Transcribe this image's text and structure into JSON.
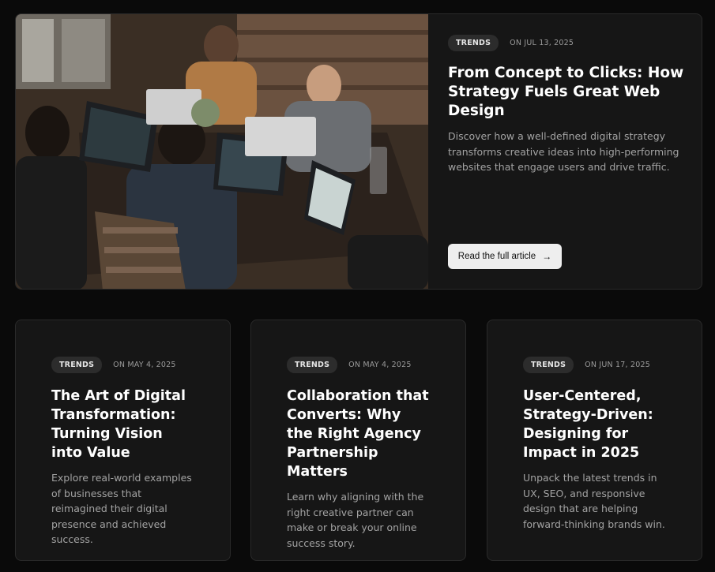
{
  "featured": {
    "tag": "TRENDS",
    "date": "ON JUL 13, 2025",
    "title": "From Concept to Clicks: How Strategy Fuels Great Web Design",
    "description": "Discover how a well-defined digital strategy transforms creative ideas into high-performing websites that engage users and drive traffic.",
    "button_label": "Read the full article",
    "button_icon": "arrow-right-icon",
    "image_subject": "team-working-on-laptops"
  },
  "cards": [
    {
      "tag": "TRENDS",
      "date": "ON MAY 4, 2025",
      "title": "The Art of Digital Transformation: Turning Vision into Value",
      "description": "Explore real-world examples of businesses that reimagined their digital presence and achieved success."
    },
    {
      "tag": "TRENDS",
      "date": "ON MAY 4, 2025",
      "title": "Collaboration that Converts: Why the Right Agency Partnership Matters",
      "description": "Learn why aligning with the right creative partner can make or break your online success story."
    },
    {
      "tag": "TRENDS",
      "date": "ON JUN 17, 2025",
      "title": "User-Centered, Strategy-Driven: Designing for Impact in 2025",
      "description": "Unpack the latest trends in UX, SEO, and responsive design that are helping forward-thinking brands win."
    }
  ],
  "colors": {
    "background": "#0a0a0a",
    "card": "#161616",
    "tag_bg": "#2c2c2c",
    "button_bg": "#eeeeee"
  }
}
